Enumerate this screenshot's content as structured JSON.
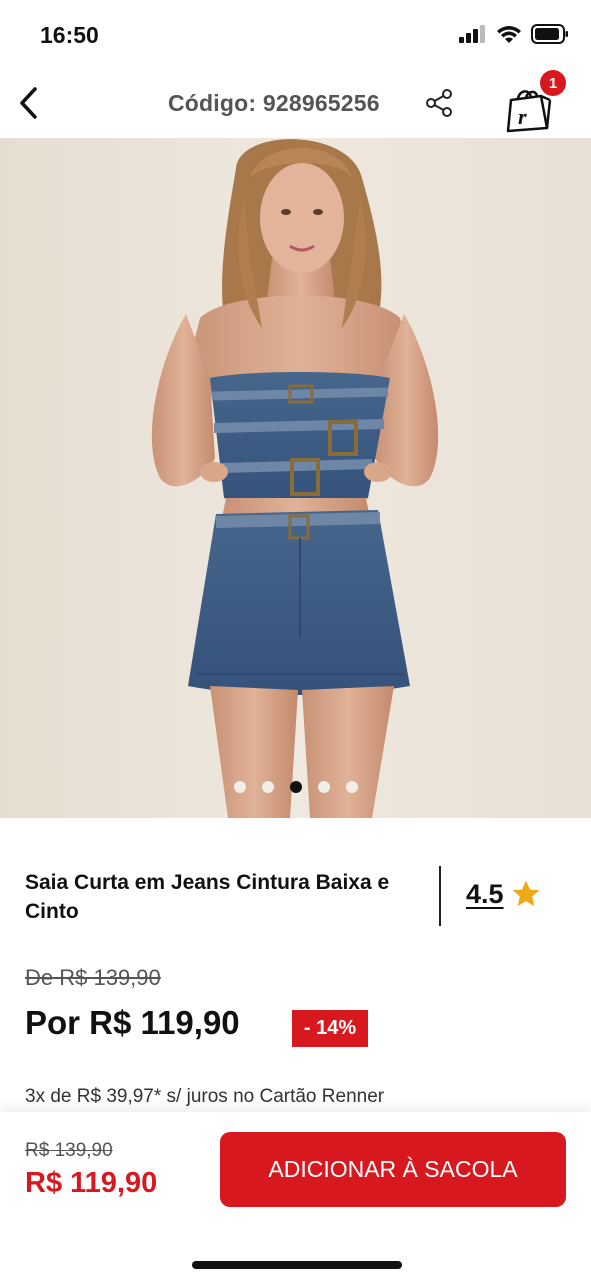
{
  "status_bar": {
    "time": "16:50"
  },
  "header": {
    "back_icon": "chevron-left-icon",
    "code_text": "Código: 928965256",
    "share_icon": "share-icon",
    "bag_icon": "shopping-bag-icon",
    "bag_count": "1"
  },
  "gallery": {
    "dot_count": 5,
    "active_dot": 3
  },
  "product": {
    "title": "Saia Curta em Jeans Cintura Baixa e Cinto",
    "rating": "4.5",
    "rating_icon": "star-icon",
    "old_price": "De R$ 139,90",
    "new_price": "Por R$ 119,90",
    "discount": "- 14%",
    "installments": "3x de R$ 39,97* s/ juros no Cartão Renner"
  },
  "bottom_bar": {
    "old_price": "R$ 139,90",
    "new_price": "R$ 119,90",
    "add_button_label": "ADICIONAR À SACOLA"
  },
  "colors": {
    "accent": "#d8181f",
    "background_photo": "#ebe3d8",
    "denim": "#3e5f86"
  }
}
